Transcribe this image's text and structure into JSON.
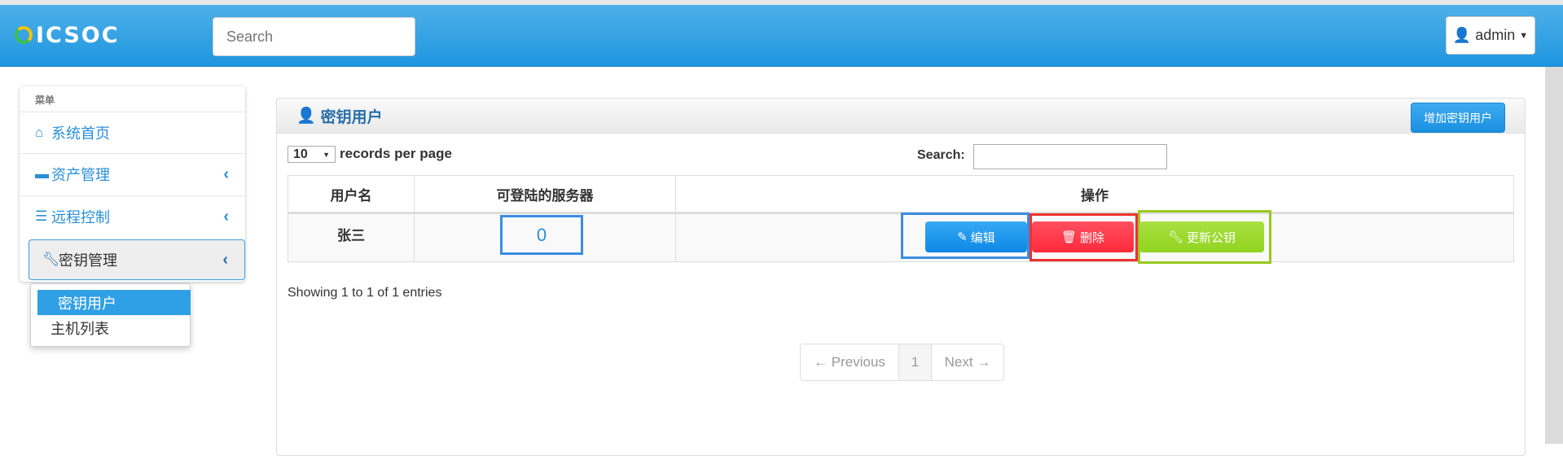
{
  "header": {
    "logo": "ICSOC",
    "search_placeholder": "Search",
    "user": "admin"
  },
  "sidebar": {
    "heading": "菜单",
    "items": [
      {
        "label": "系统首页"
      },
      {
        "label": "资产管理"
      },
      {
        "label": "远程控制"
      },
      {
        "label": "密钥管理"
      }
    ],
    "submenu": [
      {
        "label": "密钥用户"
      },
      {
        "label": "主机列表"
      }
    ]
  },
  "panel": {
    "title": "密钥用户",
    "add_button": "增加密钥用户",
    "page_length": "10",
    "records_label": "records per page",
    "search_label": "Search:",
    "columns": [
      "用户名",
      "可登陆的服务器",
      "操作"
    ],
    "rows": [
      {
        "username": "张三",
        "servers": "0",
        "actions": {
          "edit": "编辑",
          "delete": "删除",
          "update_key": "更新公钥"
        }
      }
    ],
    "info": "Showing 1 to 1 of 1 entries",
    "pagination": {
      "previous": "← Previous",
      "current": "1",
      "next": "Next →"
    }
  },
  "colors": {
    "header": "#1e96e0",
    "edit": "#1a90e0",
    "delete": "#ff3040",
    "update": "#9ad828"
  }
}
